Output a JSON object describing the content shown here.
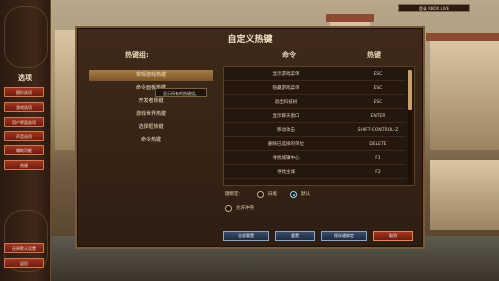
{
  "sidebar": {
    "title": "选项",
    "items": [
      {
        "label": "图形选项"
      },
      {
        "label": "游戏选项"
      },
      {
        "label": "用户界面选项"
      },
      {
        "label": "声音选项"
      },
      {
        "label": "辅助功能"
      },
      {
        "label": "热键"
      }
    ],
    "restore_label": "还原默认设置",
    "back_label": "返回"
  },
  "header_tag": "登录 XBOX LIVE",
  "dialog": {
    "title": "自定义热键",
    "groups_header": "热键组:",
    "command_header": "命令",
    "hotkey_header": "热键",
    "groups": [
      {
        "label": "常规游戏热键",
        "selected": true
      },
      {
        "label": "命令面板热键",
        "selected": false
      },
      {
        "label": "开发者热键",
        "selected": false
      },
      {
        "label": "游戏世界热键",
        "selected": false
      },
      {
        "label": "选择框热键",
        "selected": false
      },
      {
        "label": "命令热键",
        "selected": false
      }
    ],
    "tooltip": "显示所有的热键组。",
    "rows": [
      {
        "command": "显示游戏菜单",
        "hotkey": "ESC"
      },
      {
        "command": "隐藏游戏菜单",
        "hotkey": "ESC"
      },
      {
        "command": "退出科技树",
        "hotkey": "ESC"
      },
      {
        "command": "显示聊天窗口",
        "hotkey": "ENTER"
      },
      {
        "command": "移动攻击",
        "hotkey": "SHIFT-CONTROL-Z"
      },
      {
        "command": "删除已选择的单位",
        "hotkey": "DELETE"
      },
      {
        "command": "寻找城镇中心",
        "hotkey": "F1"
      },
      {
        "command": "寻找主城",
        "hotkey": "F2"
      }
    ],
    "keyboard_label": "键绑定:",
    "options": [
      {
        "label": "旧版",
        "selected": false
      },
      {
        "label": "默认",
        "selected": true
      }
    ],
    "allow_conflict_label": "允许冲突",
    "allow_conflict_selected": false,
    "buttons": {
      "reset": "全部重置",
      "reset_one": "重置",
      "save": "保存键绑定",
      "cancel": "取消"
    }
  }
}
